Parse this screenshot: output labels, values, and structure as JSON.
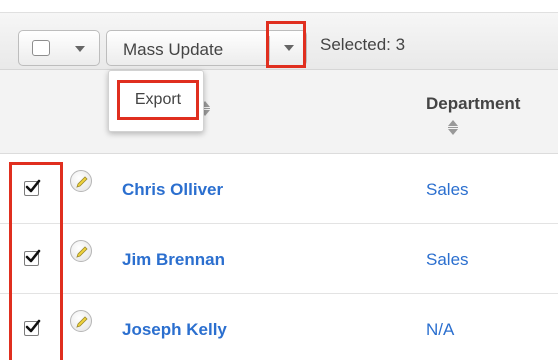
{
  "toolbar": {
    "mass_update_label": "Mass Update",
    "selected_text": "Selected: 3"
  },
  "dropdown": {
    "items": [
      {
        "label": "Export"
      }
    ]
  },
  "columns": {
    "department": "Department"
  },
  "rows": [
    {
      "name": "Chris Olliver",
      "department": "Sales",
      "checked": true
    },
    {
      "name": "Jim Brennan",
      "department": "Sales",
      "checked": true
    },
    {
      "name": "Joseph Kelly",
      "department": "N/A",
      "checked": true
    }
  ],
  "colors": {
    "highlight": "#e02f1f",
    "link": "#2b6fcf"
  }
}
